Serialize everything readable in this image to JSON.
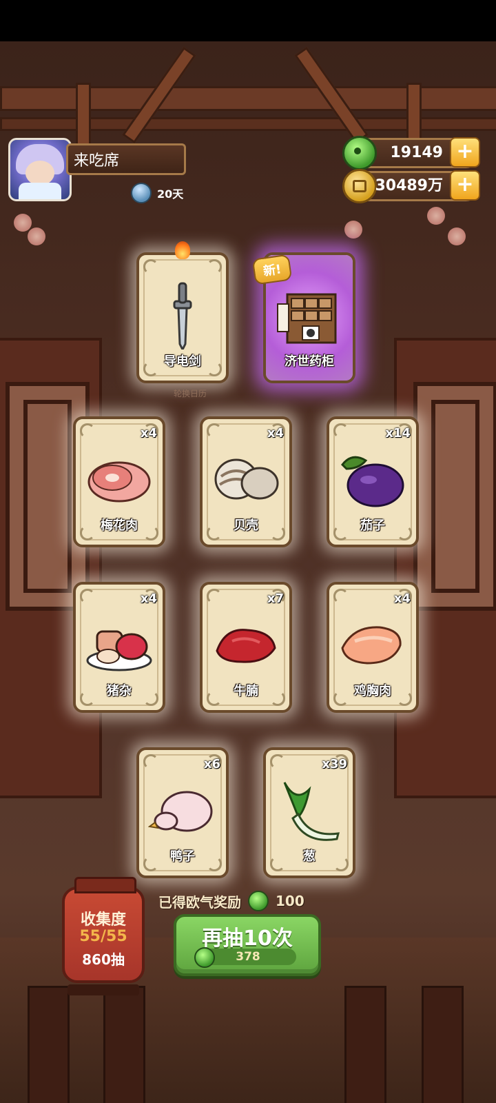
{
  "player": {
    "name": "来吃席",
    "days_label": "20天"
  },
  "currencies": {
    "jade": {
      "value": "19149",
      "icon": "jade-icon"
    },
    "coins": {
      "value": "30489万",
      "icon": "coin-icon"
    }
  },
  "featured": [
    {
      "label": "导电剑",
      "icon": "sword-icon"
    },
    {
      "label": "济世药柜",
      "icon": "medicine-cabinet-icon",
      "tag": "新!"
    }
  ],
  "sub_label": "轮换日历",
  "cards": [
    {
      "label": "梅花肉",
      "count": "x4",
      "icon": "pork-icon"
    },
    {
      "label": "贝壳",
      "count": "x4",
      "icon": "shell-icon"
    },
    {
      "label": "茄子",
      "count": "x14",
      "icon": "eggplant-icon"
    },
    {
      "label": "猪杂",
      "count": "x4",
      "icon": "pork-offal-icon"
    },
    {
      "label": "牛腩",
      "count": "x7",
      "icon": "beef-icon"
    },
    {
      "label": "鸡胸肉",
      "count": "x4",
      "icon": "chicken-breast-icon"
    },
    {
      "label": "鸭子",
      "count": "x6",
      "icon": "duck-icon"
    },
    {
      "label": "葱",
      "count": "x39",
      "icon": "scallion-icon"
    }
  ],
  "bonus": {
    "label": "已得欧气奖励",
    "value": "100"
  },
  "collection": {
    "title": "收集度",
    "progress": "55/55",
    "draws": "860抽"
  },
  "draw_button": {
    "label": "再抽10次",
    "cost": "378"
  },
  "colors": {
    "accent_green": "#6ab846",
    "card_bg": "#f1e3c0",
    "special_glow": "#c36ef0"
  }
}
